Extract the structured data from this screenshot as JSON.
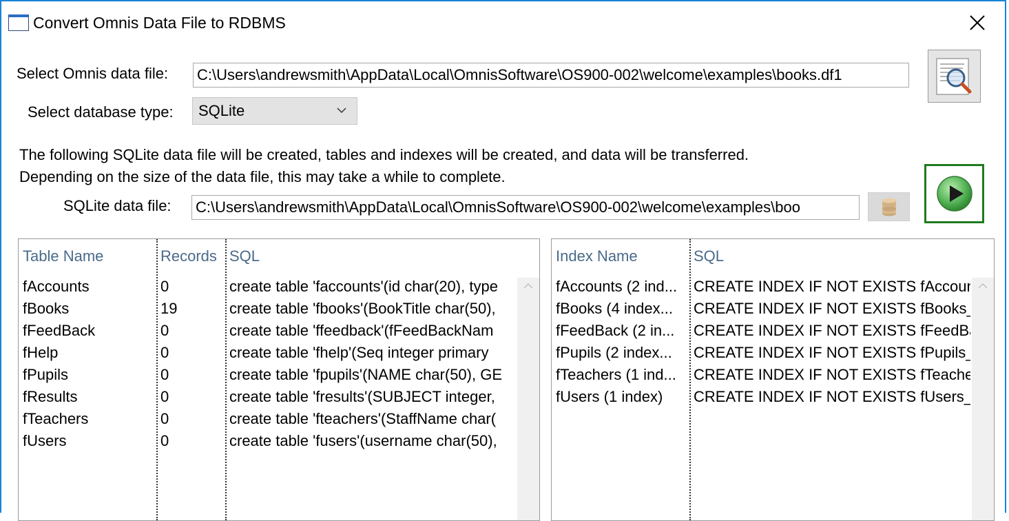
{
  "window": {
    "title": "Convert Omnis Data File to RDBMS"
  },
  "form": {
    "data_file_label": "Select Omnis data file:",
    "data_file_value": "C:\\Users\\andrewsmith\\AppData\\Local\\OmnisSoftware\\OS900-002\\welcome\\examples\\books.df1",
    "db_type_label": "Select database type:",
    "db_type_value": "SQLite",
    "description_line1": "The following SQLite data file will be created, tables and indexes will be created, and data will be transferred.",
    "description_line2": "Depending on the size of the data file, this may take a while to complete.",
    "target_label": "SQLite data file:",
    "target_value": "C:\\Users\\andrewsmith\\AppData\\Local\\OmnisSoftware\\OS900-002\\welcome\\examples\\boo"
  },
  "tables": {
    "columns": [
      "Table Name",
      "Records",
      "SQL"
    ],
    "rows": [
      {
        "name": "fAccounts",
        "records": "0",
        "sql": "create table 'faccounts'(id char(20), type"
      },
      {
        "name": "fBooks",
        "records": "19",
        "sql": "create table 'fbooks'(BookTitle char(50),"
      },
      {
        "name": "fFeedBack",
        "records": "0",
        "sql": "create table 'ffeedback'(fFeedBackNam"
      },
      {
        "name": "fHelp",
        "records": "0",
        "sql": "create table 'fhelp'(Seq integer primary"
      },
      {
        "name": "fPupils",
        "records": "0",
        "sql": "create table 'fpupils'(NAME char(50), GE"
      },
      {
        "name": "fResults",
        "records": "0",
        "sql": "create table 'fresults'(SUBJECT integer,"
      },
      {
        "name": "fTeachers",
        "records": "0",
        "sql": "create table 'fteachers'(StaffName char("
      },
      {
        "name": "fUsers",
        "records": "0",
        "sql": "create table 'fusers'(username char(50),"
      }
    ]
  },
  "indexes": {
    "columns": [
      "Index Name",
      "SQL"
    ],
    "rows": [
      {
        "name": "fAccounts (2 ind...",
        "sql": "CREATE  INDEX IF NOT EXISTS fAccoun"
      },
      {
        "name": "fBooks (4 index...",
        "sql": "CREATE  INDEX IF NOT EXISTS fBooks_"
      },
      {
        "name": "fFeedBack (2 in...",
        "sql": "CREATE  INDEX IF NOT EXISTS fFeedBa"
      },
      {
        "name": "fPupils (2 index...",
        "sql": "CREATE  INDEX IF NOT EXISTS fPupils_"
      },
      {
        "name": "fTeachers (1 ind...",
        "sql": "CREATE  INDEX IF NOT EXISTS fTeache"
      },
      {
        "name": "fUsers (1 index)",
        "sql": "CREATE  INDEX IF NOT EXISTS fUsers_"
      }
    ]
  },
  "icons": {
    "close": "close-icon",
    "browse": "magnifier-document-icon",
    "database": "database-icon",
    "run": "play-icon",
    "dropdown": "chevron-down-icon"
  },
  "colors": {
    "window_border": "#1883d7",
    "header_text": "#4a6a8a",
    "run_border": "#1f7a1f",
    "run_fill": "#5cb85c"
  }
}
